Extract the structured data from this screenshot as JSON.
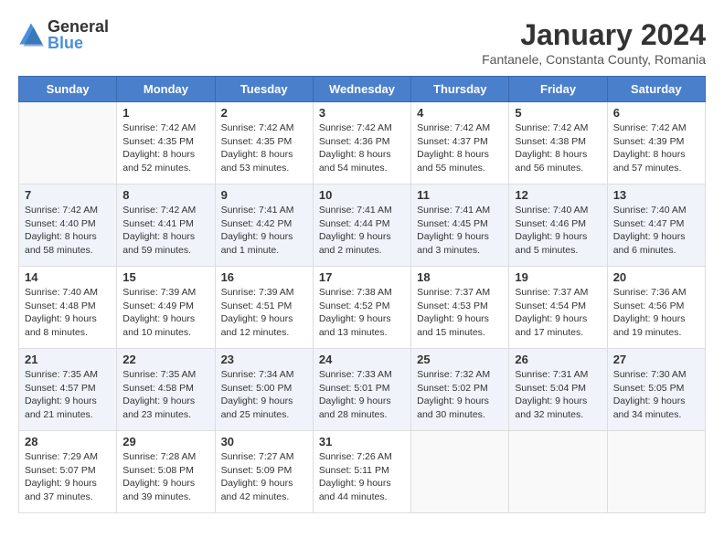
{
  "logo": {
    "text_general": "General",
    "text_blue": "Blue"
  },
  "title": "January 2024",
  "subtitle": "Fantanele, Constanta County, Romania",
  "headers": [
    "Sunday",
    "Monday",
    "Tuesday",
    "Wednesday",
    "Thursday",
    "Friday",
    "Saturday"
  ],
  "weeks": [
    [
      {
        "day": "",
        "info": ""
      },
      {
        "day": "1",
        "info": "Sunrise: 7:42 AM\nSunset: 4:35 PM\nDaylight: 8 hours\nand 52 minutes."
      },
      {
        "day": "2",
        "info": "Sunrise: 7:42 AM\nSunset: 4:35 PM\nDaylight: 8 hours\nand 53 minutes."
      },
      {
        "day": "3",
        "info": "Sunrise: 7:42 AM\nSunset: 4:36 PM\nDaylight: 8 hours\nand 54 minutes."
      },
      {
        "day": "4",
        "info": "Sunrise: 7:42 AM\nSunset: 4:37 PM\nDaylight: 8 hours\nand 55 minutes."
      },
      {
        "day": "5",
        "info": "Sunrise: 7:42 AM\nSunset: 4:38 PM\nDaylight: 8 hours\nand 56 minutes."
      },
      {
        "day": "6",
        "info": "Sunrise: 7:42 AM\nSunset: 4:39 PM\nDaylight: 8 hours\nand 57 minutes."
      }
    ],
    [
      {
        "day": "7",
        "info": "Sunrise: 7:42 AM\nSunset: 4:40 PM\nDaylight: 8 hours\nand 58 minutes."
      },
      {
        "day": "8",
        "info": "Sunrise: 7:42 AM\nSunset: 4:41 PM\nDaylight: 8 hours\nand 59 minutes."
      },
      {
        "day": "9",
        "info": "Sunrise: 7:41 AM\nSunset: 4:42 PM\nDaylight: 9 hours\nand 1 minute."
      },
      {
        "day": "10",
        "info": "Sunrise: 7:41 AM\nSunset: 4:44 PM\nDaylight: 9 hours\nand 2 minutes."
      },
      {
        "day": "11",
        "info": "Sunrise: 7:41 AM\nSunset: 4:45 PM\nDaylight: 9 hours\nand 3 minutes."
      },
      {
        "day": "12",
        "info": "Sunrise: 7:40 AM\nSunset: 4:46 PM\nDaylight: 9 hours\nand 5 minutes."
      },
      {
        "day": "13",
        "info": "Sunrise: 7:40 AM\nSunset: 4:47 PM\nDaylight: 9 hours\nand 6 minutes."
      }
    ],
    [
      {
        "day": "14",
        "info": "Sunrise: 7:40 AM\nSunset: 4:48 PM\nDaylight: 9 hours\nand 8 minutes."
      },
      {
        "day": "15",
        "info": "Sunrise: 7:39 AM\nSunset: 4:49 PM\nDaylight: 9 hours\nand 10 minutes."
      },
      {
        "day": "16",
        "info": "Sunrise: 7:39 AM\nSunset: 4:51 PM\nDaylight: 9 hours\nand 12 minutes."
      },
      {
        "day": "17",
        "info": "Sunrise: 7:38 AM\nSunset: 4:52 PM\nDaylight: 9 hours\nand 13 minutes."
      },
      {
        "day": "18",
        "info": "Sunrise: 7:37 AM\nSunset: 4:53 PM\nDaylight: 9 hours\nand 15 minutes."
      },
      {
        "day": "19",
        "info": "Sunrise: 7:37 AM\nSunset: 4:54 PM\nDaylight: 9 hours\nand 17 minutes."
      },
      {
        "day": "20",
        "info": "Sunrise: 7:36 AM\nSunset: 4:56 PM\nDaylight: 9 hours\nand 19 minutes."
      }
    ],
    [
      {
        "day": "21",
        "info": "Sunrise: 7:35 AM\nSunset: 4:57 PM\nDaylight: 9 hours\nand 21 minutes."
      },
      {
        "day": "22",
        "info": "Sunrise: 7:35 AM\nSunset: 4:58 PM\nDaylight: 9 hours\nand 23 minutes."
      },
      {
        "day": "23",
        "info": "Sunrise: 7:34 AM\nSunset: 5:00 PM\nDaylight: 9 hours\nand 25 minutes."
      },
      {
        "day": "24",
        "info": "Sunrise: 7:33 AM\nSunset: 5:01 PM\nDaylight: 9 hours\nand 28 minutes."
      },
      {
        "day": "25",
        "info": "Sunrise: 7:32 AM\nSunset: 5:02 PM\nDaylight: 9 hours\nand 30 minutes."
      },
      {
        "day": "26",
        "info": "Sunrise: 7:31 AM\nSunset: 5:04 PM\nDaylight: 9 hours\nand 32 minutes."
      },
      {
        "day": "27",
        "info": "Sunrise: 7:30 AM\nSunset: 5:05 PM\nDaylight: 9 hours\nand 34 minutes."
      }
    ],
    [
      {
        "day": "28",
        "info": "Sunrise: 7:29 AM\nSunset: 5:07 PM\nDaylight: 9 hours\nand 37 minutes."
      },
      {
        "day": "29",
        "info": "Sunrise: 7:28 AM\nSunset: 5:08 PM\nDaylight: 9 hours\nand 39 minutes."
      },
      {
        "day": "30",
        "info": "Sunrise: 7:27 AM\nSunset: 5:09 PM\nDaylight: 9 hours\nand 42 minutes."
      },
      {
        "day": "31",
        "info": "Sunrise: 7:26 AM\nSunset: 5:11 PM\nDaylight: 9 hours\nand 44 minutes."
      },
      {
        "day": "",
        "info": ""
      },
      {
        "day": "",
        "info": ""
      },
      {
        "day": "",
        "info": ""
      }
    ]
  ]
}
